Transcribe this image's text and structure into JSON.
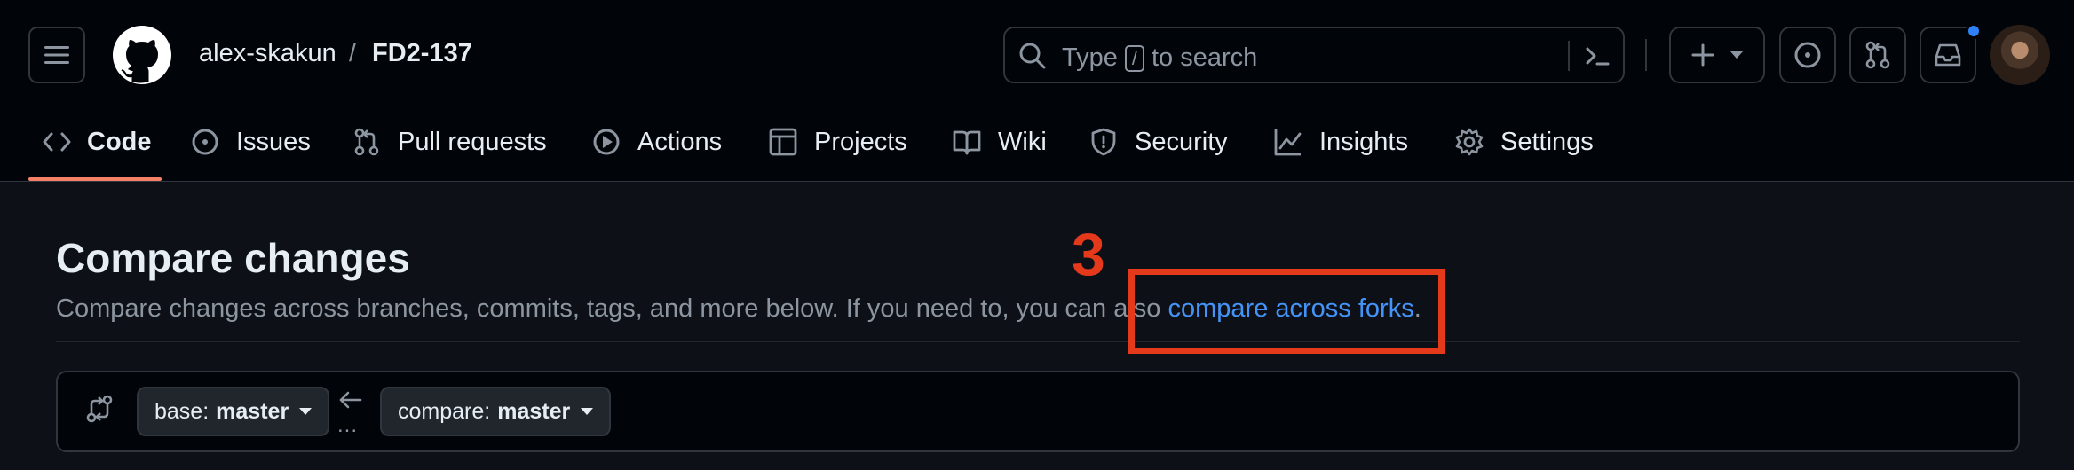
{
  "header": {
    "owner": "alex-skakun",
    "separator": "/",
    "repo": "FD2-137",
    "search": {
      "prefix": "Type",
      "key": "/",
      "suffix": "to search"
    },
    "icons": [
      "menu-icon",
      "github-logo-icon",
      "search-icon",
      "command-palette-icon",
      "plus-icon",
      "issue-icon",
      "pull-request-icon",
      "inbox-icon",
      "avatar"
    ],
    "notification_color": "#2f81f7"
  },
  "tabs": [
    {
      "label": "Code",
      "icon": "code-icon",
      "active": true
    },
    {
      "label": "Issues",
      "icon": "issue-icon"
    },
    {
      "label": "Pull requests",
      "icon": "pull-request-icon"
    },
    {
      "label": "Actions",
      "icon": "play-icon"
    },
    {
      "label": "Projects",
      "icon": "table-icon"
    },
    {
      "label": "Wiki",
      "icon": "book-icon"
    },
    {
      "label": "Security",
      "icon": "shield-icon"
    },
    {
      "label": "Insights",
      "icon": "graph-icon"
    },
    {
      "label": "Settings",
      "icon": "gear-icon"
    }
  ],
  "compare": {
    "title": "Compare changes",
    "subtitle_text": "Compare changes across branches, commits, tags, and more below. If you need to, you can also",
    "link_text": "compare across forks",
    "period": ".",
    "base_label": "base:",
    "base_value": "master",
    "compare_label": "compare:",
    "compare_value": "master",
    "dots": "..."
  },
  "annotation": {
    "number": "3",
    "color": "#e5391c"
  },
  "colors": {
    "accent_tab": "#f78166",
    "link": "#4493f8"
  }
}
